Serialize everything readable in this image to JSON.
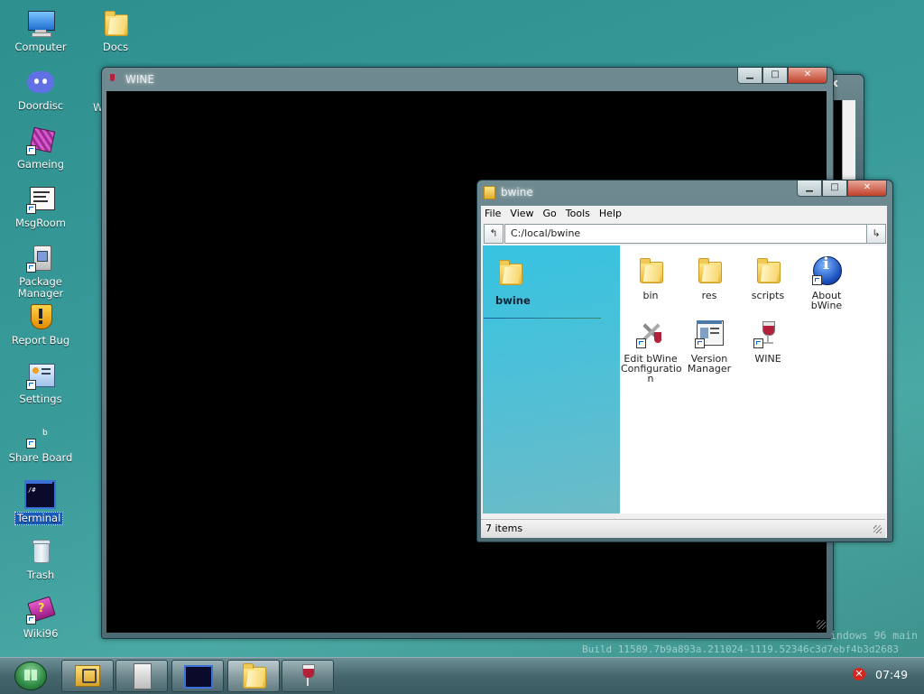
{
  "desktop": {
    "icons": [
      {
        "label": "Computer",
        "icon": "computer-icon"
      },
      {
        "label": "Docs",
        "icon": "folder-icon"
      },
      {
        "label": "Doordisc",
        "icon": "discord-icon"
      },
      {
        "label": "Gameing",
        "icon": "cube-icon"
      },
      {
        "label": "MsgRoom",
        "icon": "chat-window-icon"
      },
      {
        "label": "Package Manager",
        "icon": "package-icon"
      },
      {
        "label": "Report Bug",
        "icon": "shield-warning-icon"
      },
      {
        "label": "Settings",
        "icon": "settings-panel-icon"
      },
      {
        "label": "Share Board",
        "icon": "share-icon"
      },
      {
        "label": "Terminal",
        "icon": "terminal-icon"
      },
      {
        "label": "Trash",
        "icon": "trash-icon"
      },
      {
        "label": "Wiki96",
        "icon": "book-icon"
      }
    ],
    "wine_window_label": "Wi"
  },
  "wine_window": {
    "title": "WINE",
    "back_close": "x"
  },
  "explorer": {
    "title": "bwine",
    "menu": [
      "File",
      "View",
      "Go",
      "Tools",
      "Help"
    ],
    "address": "C:/local/bwine",
    "back_glyph": "↰",
    "go_glyph": "↳",
    "sidebar_title": "bwine",
    "items": [
      {
        "label": "bin",
        "icon": "folder-icon"
      },
      {
        "label": "res",
        "icon": "folder-icon"
      },
      {
        "label": "scripts",
        "icon": "folder-icon"
      },
      {
        "label": "About bWine",
        "icon": "info-icon"
      },
      {
        "label": "Edit bWine Configuratio n",
        "icon": "tools-icon"
      },
      {
        "label": "Version Manager",
        "icon": "window-icon"
      },
      {
        "label": "WINE",
        "icon": "wine-glass-icon"
      }
    ],
    "status": "7 items"
  },
  "watermark": {
    "line1": "indows 96 main",
    "line2": "Build 11589.7b9a893a.211024-1119.52346c3d7ebf4b3d2683"
  },
  "taskbar": {
    "clock": "07:49",
    "tray_error": "✕",
    "buttons": [
      "package-manager-icon",
      "package-icon",
      "terminal-icon",
      "folder-icon",
      "wine-glass-icon"
    ]
  },
  "colors": {
    "sidebar": "#3fc3d6",
    "accent": "#1a5bb8",
    "close": "#c0402a"
  }
}
